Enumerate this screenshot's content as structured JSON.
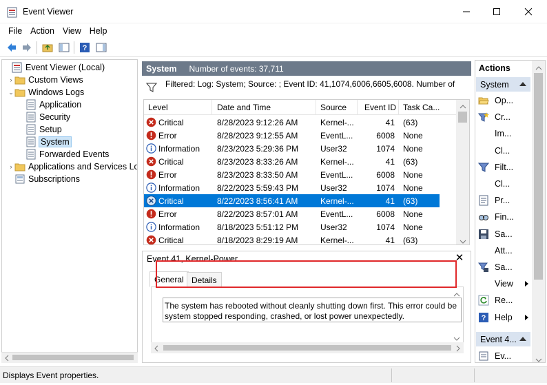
{
  "window": {
    "title": "Event Viewer"
  },
  "menu": [
    "File",
    "Action",
    "View",
    "Help"
  ],
  "tree": {
    "items": [
      {
        "label": "Event Viewer (Local)",
        "level": 0,
        "twisty": "",
        "icon": "event-viewer-icon"
      },
      {
        "label": "Custom Views",
        "level": 1,
        "twisty": "›",
        "icon": "folder-icon"
      },
      {
        "label": "Windows Logs",
        "level": 1,
        "twisty": "⌄",
        "icon": "folder-icon"
      },
      {
        "label": "Application",
        "level": 2,
        "twisty": "",
        "icon": "log-icon"
      },
      {
        "label": "Security",
        "level": 2,
        "twisty": "",
        "icon": "log-icon"
      },
      {
        "label": "Setup",
        "level": 2,
        "twisty": "",
        "icon": "log-icon"
      },
      {
        "label": "System",
        "level": 2,
        "twisty": "",
        "icon": "log-icon",
        "selected": true
      },
      {
        "label": "Forwarded Events",
        "level": 2,
        "twisty": "",
        "icon": "log-icon"
      },
      {
        "label": "Applications and Services Lo",
        "level": 1,
        "twisty": "›",
        "icon": "folder-icon"
      },
      {
        "label": "Subscriptions",
        "level": 1,
        "twisty": "",
        "icon": "subscriptions-icon"
      }
    ]
  },
  "center": {
    "title": "System",
    "event_count": "Number of events: 37,711",
    "filter": "Filtered: Log: System; Source: ; Event ID: 41,1074,6006,6605,6008. Number of",
    "columns": [
      "Level",
      "Date and Time",
      "Source",
      "Event ID",
      "Task Ca..."
    ],
    "rows": [
      {
        "level": "Critical",
        "type": "critical",
        "date": "8/28/2023 9:12:26 AM",
        "source": "Kernel-...",
        "id": "41",
        "task": "(63)"
      },
      {
        "level": "Error",
        "type": "error",
        "date": "8/28/2023 9:12:55 AM",
        "source": "EventL...",
        "id": "6008",
        "task": "None"
      },
      {
        "level": "Information",
        "type": "info",
        "date": "8/23/2023 5:29:36 PM",
        "source": "User32",
        "id": "1074",
        "task": "None"
      },
      {
        "level": "Critical",
        "type": "critical",
        "date": "8/23/2023 8:33:26 AM",
        "source": "Kernel-...",
        "id": "41",
        "task": "(63)"
      },
      {
        "level": "Error",
        "type": "error",
        "date": "8/23/2023 8:33:50 AM",
        "source": "EventL...",
        "id": "6008",
        "task": "None"
      },
      {
        "level": "Information",
        "type": "info",
        "date": "8/22/2023 5:59:43 PM",
        "source": "User32",
        "id": "1074",
        "task": "None"
      },
      {
        "level": "Critical",
        "type": "critical",
        "date": "8/22/2023 8:56:41 AM",
        "source": "Kernel-...",
        "id": "41",
        "task": "(63)",
        "selected": true
      },
      {
        "level": "Error",
        "type": "error",
        "date": "8/22/2023 8:57:01 AM",
        "source": "EventL...",
        "id": "6008",
        "task": "None"
      },
      {
        "level": "Information",
        "type": "info",
        "date": "8/18/2023 5:51:12 PM",
        "source": "User32",
        "id": "1074",
        "task": "None"
      },
      {
        "level": "Critical",
        "type": "critical",
        "date": "8/18/2023 8:29:19 AM",
        "source": "Kernel-...",
        "id": "41",
        "task": "(63)"
      }
    ]
  },
  "detail": {
    "title": "Event 41, Kernel-Power",
    "tabs": [
      "General",
      "Details"
    ],
    "description_line1": "The system has rebooted without cleanly shutting down first. This error could be",
    "description_line2": "system stopped responding, crashed, or lost power unexpectedly."
  },
  "actions": {
    "title": "Actions",
    "section1": "System",
    "items": [
      {
        "label": "Op...",
        "icon": "open-folder-icon"
      },
      {
        "label": "Cr...",
        "icon": "create-filter-icon"
      },
      {
        "label": "Im...",
        "icon": ""
      },
      {
        "label": "Cl...",
        "icon": ""
      },
      {
        "label": "Filt...",
        "icon": "filter-icon"
      },
      {
        "label": "Cl...",
        "icon": ""
      },
      {
        "label": "Pr...",
        "icon": "properties-icon"
      },
      {
        "label": "Fin...",
        "icon": "find-icon"
      },
      {
        "label": "Sa...",
        "icon": "save-icon"
      },
      {
        "label": "Att...",
        "icon": ""
      },
      {
        "label": "Sa...",
        "icon": "save-filter-icon"
      },
      {
        "label": "View",
        "icon": "",
        "submenu": true
      },
      {
        "label": "Re...",
        "icon": "refresh-icon"
      },
      {
        "label": "Help",
        "icon": "help-icon",
        "submenu": true
      }
    ],
    "section2": "Event 4...",
    "items2": [
      {
        "label": "Ev...",
        "icon": "event-properties-icon"
      }
    ]
  },
  "status": {
    "text": "Displays Event properties."
  },
  "colors": {
    "header_bg": "#6d7a8a",
    "selection": "#0078d7",
    "section_bg": "#d9e3f0",
    "highlight_frame": "#e0282a"
  }
}
